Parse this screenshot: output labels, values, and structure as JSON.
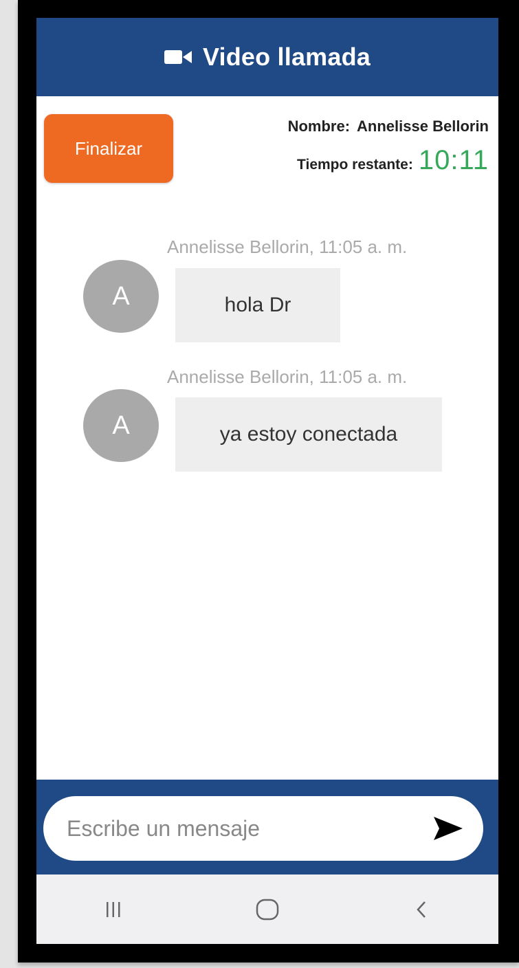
{
  "header": {
    "title": "Video llamada",
    "icon": "video-camera-icon"
  },
  "call": {
    "end_label": "Finalizar",
    "name_label": "Nombre:",
    "name_value": "Annelisse Bellorin",
    "time_label": "Tiempo restante:",
    "time_value": "10:11",
    "timer_color": "#36a85a"
  },
  "messages": [
    {
      "meta": "Annelisse Bellorin, 11:05 a. m.",
      "avatar": "A",
      "text": "hola Dr"
    },
    {
      "meta": "Annelisse Bellorin, 11:05 a. m.",
      "avatar": "A",
      "text": "ya estoy conectada"
    }
  ],
  "composer": {
    "placeholder": "Escribe un mensaje",
    "send_icon": "send-icon"
  },
  "navbar": {
    "icons": [
      "recent-apps-icon",
      "home-icon",
      "back-icon"
    ]
  },
  "colors": {
    "primary": "#204a86",
    "accent": "#ee6a22"
  }
}
